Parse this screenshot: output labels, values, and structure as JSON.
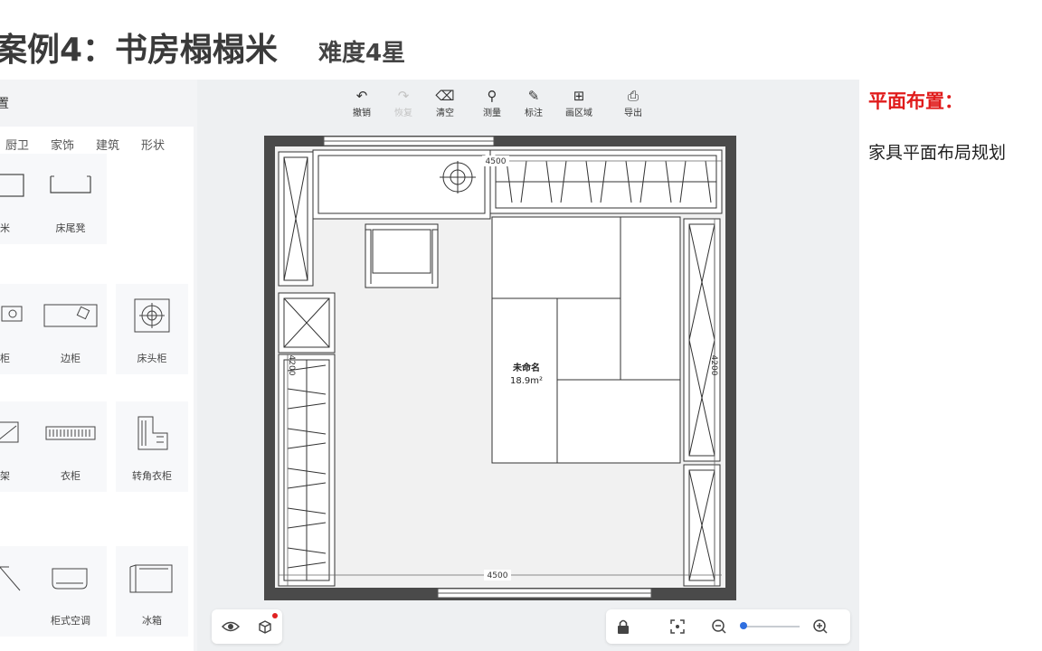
{
  "title": {
    "main": "案例4：书房榻榻米",
    "difficulty": "难度4星"
  },
  "left_panel": {
    "title": "置",
    "tabs": [
      "厨卫",
      "家饰",
      "建筑",
      "形状"
    ],
    "items": [
      {
        "label": "米",
        "icon": "bench-icon"
      },
      {
        "label": "床尾凳",
        "icon": "bed-end-stool-icon"
      },
      {
        "label": "柜",
        "icon": "cabinet-icon"
      },
      {
        "label": "边柜",
        "icon": "side-cabinet-icon"
      },
      {
        "label": "床头柜",
        "icon": "nightstand-icon"
      },
      {
        "label": "架",
        "icon": "shelf-icon"
      },
      {
        "label": "衣柜",
        "icon": "wardrobe-icon"
      },
      {
        "label": "转角衣柜",
        "icon": "corner-wardrobe-icon"
      },
      {
        "label": "柜式空调",
        "icon": "cabinet-air-conditioner-icon"
      },
      {
        "label": "冰箱",
        "icon": "fridge-icon"
      }
    ]
  },
  "toolbar": {
    "undo": "撤销",
    "redo": "恢复",
    "clear": "清空",
    "measure": "测量",
    "annotate": "标注",
    "draw_area": "画区域",
    "export": "导出"
  },
  "plan": {
    "room_name": "未命名",
    "room_area": "18.9m²",
    "dim_top": "4500",
    "dim_bottom": "4500",
    "dim_left": "4200",
    "dim_right": "4200"
  },
  "notes": {
    "heading": "平面布置：",
    "text": "家具平面布局规划"
  },
  "colors": {
    "accent_red": "#e01b1b",
    "zoom_blue": "#2f6fe0",
    "wall": "#4a4a4a"
  }
}
